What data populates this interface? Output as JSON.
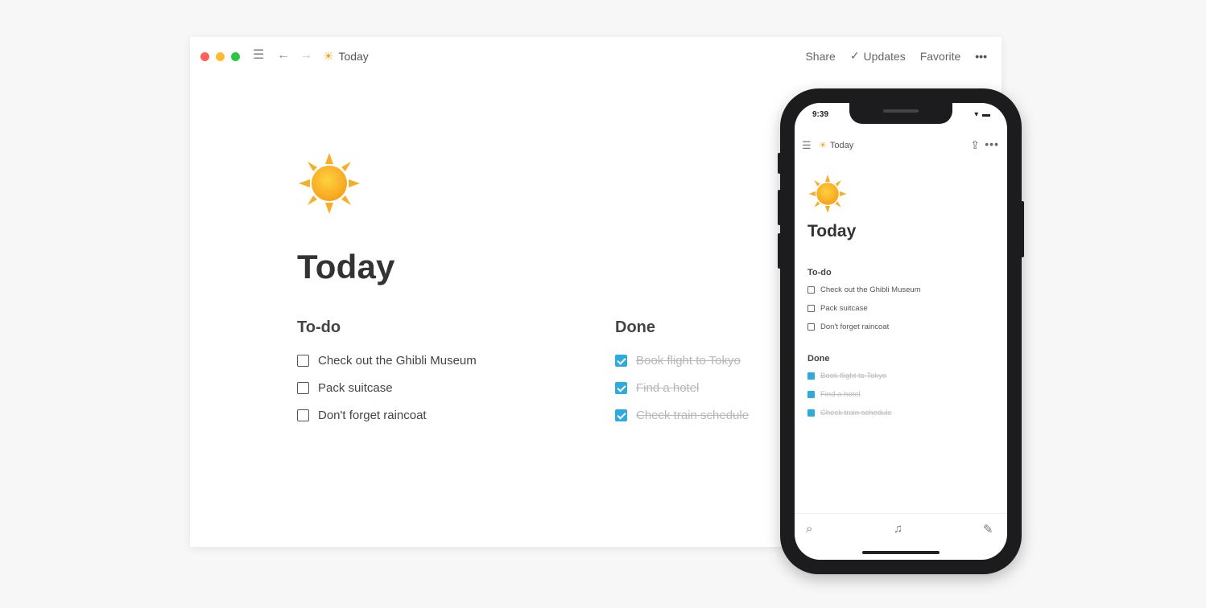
{
  "toolbar": {
    "title": "Today",
    "emoji": "☀",
    "share": "Share",
    "updates": "Updates",
    "favorite": "Favorite",
    "more": "•••",
    "back_icon": "arrow-left-icon",
    "forward_icon": "arrow-right-icon",
    "sidebar_icon": "hamburger-icon"
  },
  "page": {
    "title": "Today",
    "todo": {
      "heading": "To-do",
      "items": [
        "Check out the Ghibli Museum",
        "Pack suitcase",
        "Don't forget raincoat"
      ]
    },
    "done": {
      "heading": "Done",
      "items": [
        "Book flight to Tokyo",
        "Find a hotel",
        "Check train schedule"
      ]
    }
  },
  "mobile": {
    "time": "9:39",
    "status_icons": "▾ ▬",
    "title": "Today",
    "more": "•••",
    "todo": {
      "heading": "To-do",
      "items": [
        "Check out the Ghibli Museum",
        "Pack suitcase",
        "Don't forget raincoat"
      ]
    },
    "done": {
      "heading": "Done",
      "items": [
        "Book flight to Tokyo",
        "Find a hotel",
        "Check train schedule"
      ]
    }
  },
  "colors": {
    "accent": "#2eaadc",
    "close": "#fe5f57",
    "minimize": "#febc2e",
    "zoom": "#28c840"
  }
}
